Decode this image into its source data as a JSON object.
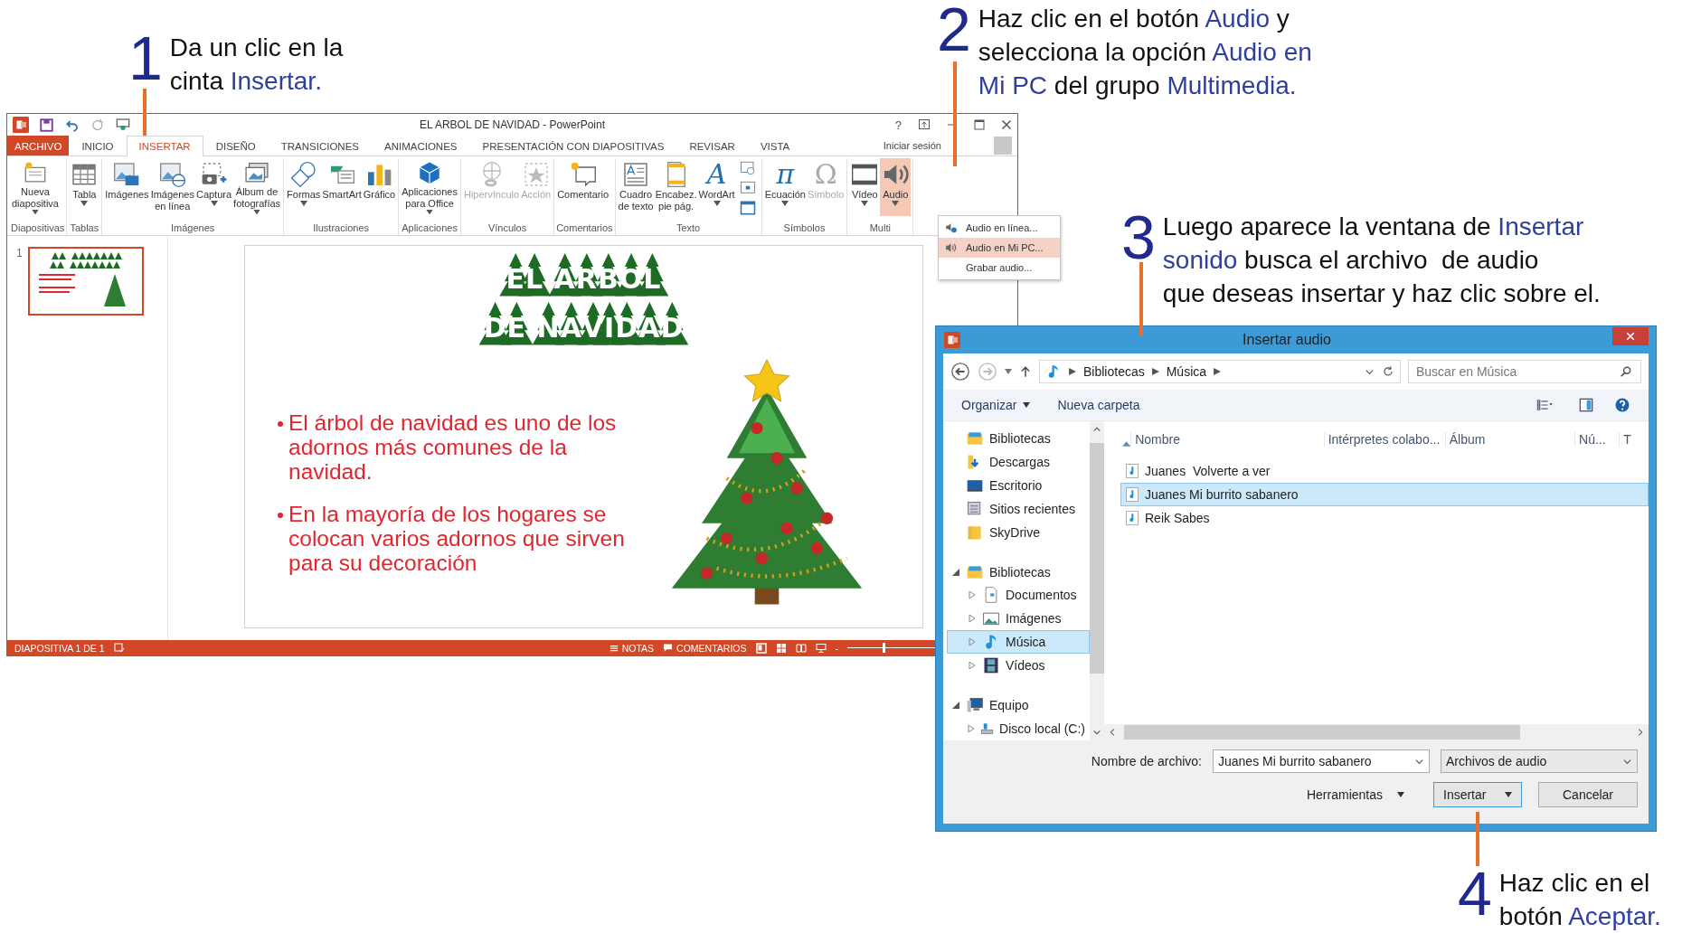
{
  "callouts": [
    {
      "number": "1",
      "text": "Da un clic en la\ncinta *Insertar.*"
    },
    {
      "number": "2",
      "text": "Haz clic en el botón *Audio* y\nselecciona la opción *Audio en*\n*Mi PC* del grupo *Multimedia.*"
    },
    {
      "number": "3",
      "text": "Luego aparece la ventana de *Insertar*\n*sonido* busca el archivo  de audio\nque deseas insertar y haz clic sobre el."
    },
    {
      "number": "4",
      "text": "Haz clic en el\nbotón *Aceptar.*"
    }
  ],
  "powerpoint": {
    "window": {
      "title": "EL ARBOL DE NAVIDAD - PowerPoint",
      "help": "?",
      "sign_in": "Iniciar sesión"
    },
    "tabs": [
      {
        "label": "ARCHIVO",
        "kind": "file",
        "selected": false
      },
      {
        "label": "INICIO",
        "kind": "tab",
        "selected": false
      },
      {
        "label": "INSERTAR",
        "kind": "tab",
        "selected": true
      },
      {
        "label": "DISEÑO",
        "kind": "tab",
        "selected": false
      },
      {
        "label": "TRANSICIONES",
        "kind": "tab",
        "selected": false
      },
      {
        "label": "ANIMACIONES",
        "kind": "tab",
        "selected": false
      },
      {
        "label": "PRESENTACIÓN CON DIAPOSITIVAS",
        "kind": "tab",
        "selected": false
      },
      {
        "label": "REVISAR",
        "kind": "tab",
        "selected": false
      },
      {
        "label": "VISTA",
        "kind": "tab",
        "selected": false
      }
    ],
    "ribbon": [
      {
        "label": "Diapositivas",
        "buttons": [
          {
            "kind": "large",
            "label": "Nueva\ndiapositiva",
            "dropdown": true,
            "disabled": false,
            "selected": false
          }
        ]
      },
      {
        "label": "Tablas",
        "buttons": [
          {
            "kind": "large",
            "label": "Tabla",
            "dropdown": true,
            "disabled": false,
            "selected": false
          }
        ]
      },
      {
        "label": "Imágenes",
        "buttons": [
          {
            "kind": "large",
            "label": "Imágenes",
            "dropdown": false,
            "disabled": false,
            "selected": false
          },
          {
            "kind": "large",
            "label": "Imágenes\nen línea",
            "dropdown": false,
            "disabled": false,
            "selected": false
          },
          {
            "kind": "large",
            "label": "Captura",
            "dropdown": true,
            "disabled": false,
            "selected": false
          },
          {
            "kind": "large",
            "label": "Álbum de\nfotografías",
            "dropdown": true,
            "disabled": false,
            "selected": false
          }
        ]
      },
      {
        "label": "Ilustraciones",
        "buttons": [
          {
            "kind": "large",
            "label": "Formas",
            "dropdown": true,
            "disabled": false,
            "selected": false
          },
          {
            "kind": "large",
            "label": "SmartArt",
            "dropdown": false,
            "disabled": false,
            "selected": false
          },
          {
            "kind": "large",
            "label": "Gráfico",
            "dropdown": false,
            "disabled": false,
            "selected": false
          }
        ]
      },
      {
        "label": "Aplicaciones",
        "buttons": [
          {
            "kind": "large",
            "label": "Aplicaciones\npara Office",
            "dropdown": true,
            "disabled": false,
            "selected": false
          }
        ]
      },
      {
        "label": "Vínculos",
        "buttons": [
          {
            "kind": "large",
            "label": "Hipervínculo",
            "dropdown": false,
            "disabled": true,
            "selected": false
          },
          {
            "kind": "large",
            "label": "Acción",
            "dropdown": false,
            "disabled": true,
            "selected": false
          }
        ]
      },
      {
        "label": "Comentarios",
        "buttons": [
          {
            "kind": "large",
            "label": "Comentario",
            "dropdown": false,
            "disabled": false,
            "selected": false
          }
        ]
      },
      {
        "label": "Texto",
        "buttons": [
          {
            "kind": "large",
            "label": "Cuadro\nde texto",
            "dropdown": false,
            "disabled": false,
            "selected": false
          },
          {
            "kind": "large",
            "label": "Encabez.\npie pág.",
            "dropdown": false,
            "disabled": false,
            "selected": false
          },
          {
            "kind": "glyph",
            "glyph": "A",
            "label": "WordArt",
            "dropdown": true,
            "disabled": false,
            "selected": false
          },
          {
            "kind": "stack"
          }
        ]
      },
      {
        "label": "Símbolos",
        "buttons": [
          {
            "kind": "glyph",
            "glyph": "π",
            "label": "Ecuación",
            "dropdown": true,
            "disabled": false,
            "selected": false
          },
          {
            "kind": "glyph",
            "glyph": "Ω",
            "label": "Símbolo",
            "dropdown": false,
            "disabled": true,
            "selected": false
          }
        ]
      },
      {
        "label": "Multi",
        "buttons": [
          {
            "kind": "large",
            "label": "Vídeo",
            "dropdown": true,
            "disabled": false,
            "selected": false
          },
          {
            "kind": "large",
            "label": "Audio",
            "dropdown": true,
            "disabled": false,
            "selected": true
          }
        ]
      }
    ],
    "audio_menu": [
      {
        "label": "Audio en línea...",
        "selected": false
      },
      {
        "label": "Audio en Mi PC...",
        "selected": true
      },
      {
        "label": "Grabar audio...",
        "selected": false
      }
    ],
    "thumbnail": {
      "number": "1"
    },
    "slide": {
      "title_lines": [
        "EL ARBOL",
        "DE NAVIDAD"
      ],
      "bullets": [
        "El árbol de navidad es uno de los adornos más comunes de la navidad.",
        "En la mayoría de los hogares se colocan varios adornos que sirven para su decoración"
      ]
    },
    "status_bar": {
      "slide": "DIAPOSITIVA 1 DE 1",
      "notes": "NOTAS",
      "comments": "COMENTARIOS",
      "zoom_out": "-",
      "zoom": {
        "level": 0.35
      }
    }
  },
  "dialog": {
    "title": "Insertar audio",
    "breadcrumb": [
      "Bibliotecas",
      "Música"
    ],
    "search": {
      "placeholder": "Buscar en Música"
    },
    "toolbar": {
      "organize": "Organizar",
      "new_folder": "Nueva carpeta"
    },
    "nav": [
      {
        "label": "Bibliotecas",
        "selected": false
      },
      {
        "label": "Descargas",
        "selected": false
      },
      {
        "label": "Escritorio",
        "selected": false
      },
      {
        "label": "Sitios recientes",
        "selected": false
      },
      {
        "label": "SkyDrive",
        "selected": false
      },
      {
        "label": "Bibliotecas",
        "selected": false,
        "expanded": true,
        "children": [
          {
            "label": "Documentos",
            "selected": false,
            "expanded": false
          },
          {
            "label": "Imágenes",
            "selected": false,
            "expanded": false
          },
          {
            "label": "Música",
            "selected": true,
            "expanded": false
          },
          {
            "label": "Vídeos",
            "selected": false,
            "expanded": false
          }
        ]
      },
      {
        "label": "Equipo",
        "selected": false,
        "expanded": true,
        "children": [
          {
            "label": "Disco local (C:)",
            "selected": false,
            "expanded": false
          }
        ]
      }
    ],
    "columns": [
      "Nombre",
      "Intérpretes colabo...",
      "Álbum",
      "Nú...",
      "T"
    ],
    "files": [
      {
        "name": "Juanes  Volverte a ver",
        "selected": false
      },
      {
        "name": "Juanes Mi burrito sabanero",
        "selected": true
      },
      {
        "name": "Reik Sabes",
        "selected": false
      }
    ],
    "filename_label": "Nombre de archivo:",
    "filename": "Juanes Mi burrito sabanero",
    "filetype": "Archivos de audio",
    "tools": "Herramientas",
    "insert": "Insertar",
    "cancel": "Cancelar"
  }
}
